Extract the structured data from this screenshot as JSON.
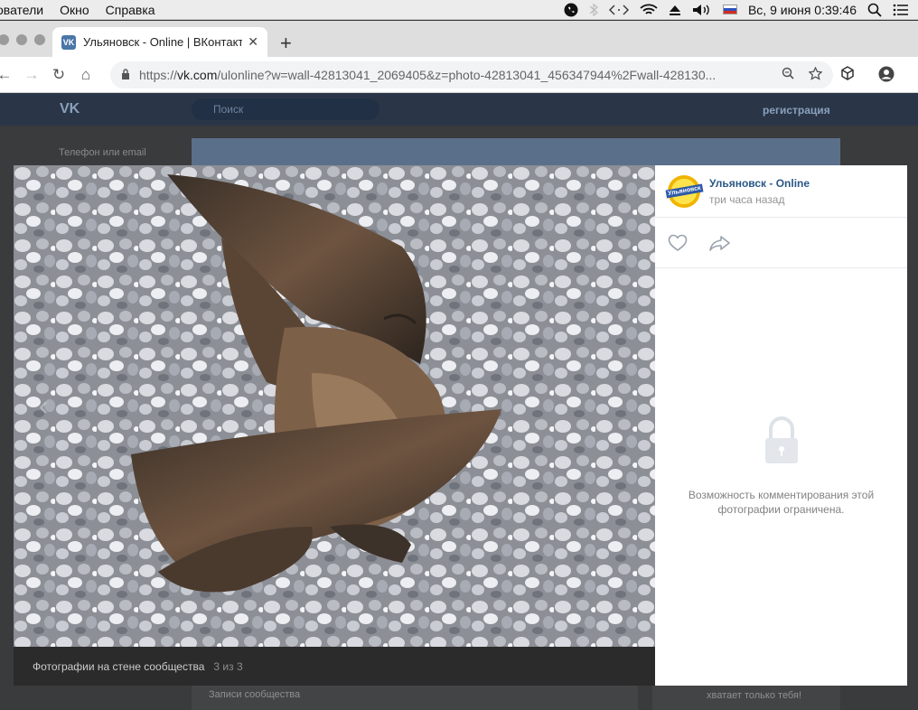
{
  "menubar": {
    "menus": [
      "ователи",
      "Окно",
      "Справка"
    ],
    "clock": "Вс, 9 июня  0:39:46"
  },
  "tab": {
    "title": "Ульяновск - Online | ВКонтакте",
    "favicon": "VK"
  },
  "address": {
    "prefix": "https://",
    "domain": "vk.com",
    "path": "/ulonline?w=wall-42813041_2069405&z=photo-42813041_456347944%2Fwall-428130..."
  },
  "vk_page": {
    "search_placeholder": "Поиск",
    "register": "регистрация",
    "login_label": "Телефон или email",
    "posts_label": "Записи сообщества",
    "side_text": "хватает только тебя!"
  },
  "viewer": {
    "album": "Фотографии на стене сообщества",
    "counter": "3 из 3",
    "author_name": "Ульяновск - Online",
    "author_avatar_text": "Ульяновск",
    "post_time": "три часа назад",
    "comments_closed": "Возможность комментирования этой фотографии ограничена."
  },
  "colors": {
    "vk_blue": "#2a5885",
    "vk_header": "#2a3648"
  }
}
